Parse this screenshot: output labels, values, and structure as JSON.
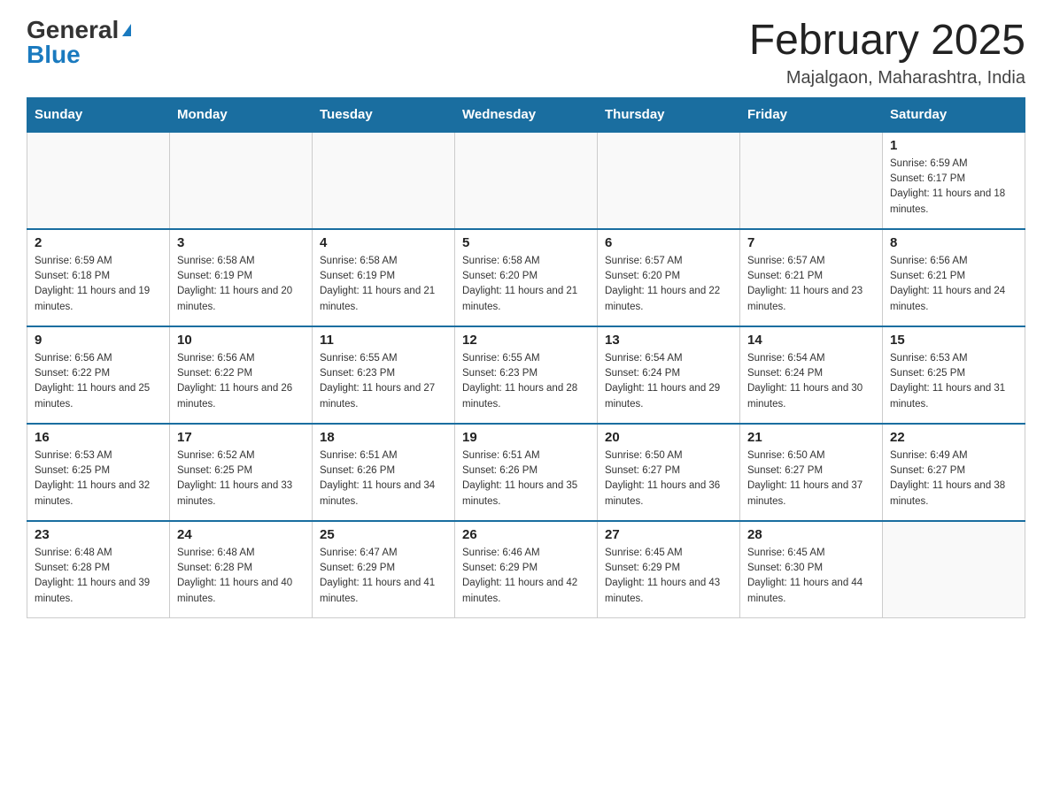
{
  "header": {
    "logo_general": "General",
    "logo_blue": "Blue",
    "month_title": "February 2025",
    "location": "Majalgaon, Maharashtra, India"
  },
  "days_of_week": [
    "Sunday",
    "Monday",
    "Tuesday",
    "Wednesday",
    "Thursday",
    "Friday",
    "Saturday"
  ],
  "weeks": [
    [
      {
        "day": "",
        "empty": true
      },
      {
        "day": "",
        "empty": true
      },
      {
        "day": "",
        "empty": true
      },
      {
        "day": "",
        "empty": true
      },
      {
        "day": "",
        "empty": true
      },
      {
        "day": "",
        "empty": true
      },
      {
        "day": "1",
        "sunrise": "Sunrise: 6:59 AM",
        "sunset": "Sunset: 6:17 PM",
        "daylight": "Daylight: 11 hours and 18 minutes."
      }
    ],
    [
      {
        "day": "2",
        "sunrise": "Sunrise: 6:59 AM",
        "sunset": "Sunset: 6:18 PM",
        "daylight": "Daylight: 11 hours and 19 minutes."
      },
      {
        "day": "3",
        "sunrise": "Sunrise: 6:58 AM",
        "sunset": "Sunset: 6:19 PM",
        "daylight": "Daylight: 11 hours and 20 minutes."
      },
      {
        "day": "4",
        "sunrise": "Sunrise: 6:58 AM",
        "sunset": "Sunset: 6:19 PM",
        "daylight": "Daylight: 11 hours and 21 minutes."
      },
      {
        "day": "5",
        "sunrise": "Sunrise: 6:58 AM",
        "sunset": "Sunset: 6:20 PM",
        "daylight": "Daylight: 11 hours and 21 minutes."
      },
      {
        "day": "6",
        "sunrise": "Sunrise: 6:57 AM",
        "sunset": "Sunset: 6:20 PM",
        "daylight": "Daylight: 11 hours and 22 minutes."
      },
      {
        "day": "7",
        "sunrise": "Sunrise: 6:57 AM",
        "sunset": "Sunset: 6:21 PM",
        "daylight": "Daylight: 11 hours and 23 minutes."
      },
      {
        "day": "8",
        "sunrise": "Sunrise: 6:56 AM",
        "sunset": "Sunset: 6:21 PM",
        "daylight": "Daylight: 11 hours and 24 minutes."
      }
    ],
    [
      {
        "day": "9",
        "sunrise": "Sunrise: 6:56 AM",
        "sunset": "Sunset: 6:22 PM",
        "daylight": "Daylight: 11 hours and 25 minutes."
      },
      {
        "day": "10",
        "sunrise": "Sunrise: 6:56 AM",
        "sunset": "Sunset: 6:22 PM",
        "daylight": "Daylight: 11 hours and 26 minutes."
      },
      {
        "day": "11",
        "sunrise": "Sunrise: 6:55 AM",
        "sunset": "Sunset: 6:23 PM",
        "daylight": "Daylight: 11 hours and 27 minutes."
      },
      {
        "day": "12",
        "sunrise": "Sunrise: 6:55 AM",
        "sunset": "Sunset: 6:23 PM",
        "daylight": "Daylight: 11 hours and 28 minutes."
      },
      {
        "day": "13",
        "sunrise": "Sunrise: 6:54 AM",
        "sunset": "Sunset: 6:24 PM",
        "daylight": "Daylight: 11 hours and 29 minutes."
      },
      {
        "day": "14",
        "sunrise": "Sunrise: 6:54 AM",
        "sunset": "Sunset: 6:24 PM",
        "daylight": "Daylight: 11 hours and 30 minutes."
      },
      {
        "day": "15",
        "sunrise": "Sunrise: 6:53 AM",
        "sunset": "Sunset: 6:25 PM",
        "daylight": "Daylight: 11 hours and 31 minutes."
      }
    ],
    [
      {
        "day": "16",
        "sunrise": "Sunrise: 6:53 AM",
        "sunset": "Sunset: 6:25 PM",
        "daylight": "Daylight: 11 hours and 32 minutes."
      },
      {
        "day": "17",
        "sunrise": "Sunrise: 6:52 AM",
        "sunset": "Sunset: 6:25 PM",
        "daylight": "Daylight: 11 hours and 33 minutes."
      },
      {
        "day": "18",
        "sunrise": "Sunrise: 6:51 AM",
        "sunset": "Sunset: 6:26 PM",
        "daylight": "Daylight: 11 hours and 34 minutes."
      },
      {
        "day": "19",
        "sunrise": "Sunrise: 6:51 AM",
        "sunset": "Sunset: 6:26 PM",
        "daylight": "Daylight: 11 hours and 35 minutes."
      },
      {
        "day": "20",
        "sunrise": "Sunrise: 6:50 AM",
        "sunset": "Sunset: 6:27 PM",
        "daylight": "Daylight: 11 hours and 36 minutes."
      },
      {
        "day": "21",
        "sunrise": "Sunrise: 6:50 AM",
        "sunset": "Sunset: 6:27 PM",
        "daylight": "Daylight: 11 hours and 37 minutes."
      },
      {
        "day": "22",
        "sunrise": "Sunrise: 6:49 AM",
        "sunset": "Sunset: 6:27 PM",
        "daylight": "Daylight: 11 hours and 38 minutes."
      }
    ],
    [
      {
        "day": "23",
        "sunrise": "Sunrise: 6:48 AM",
        "sunset": "Sunset: 6:28 PM",
        "daylight": "Daylight: 11 hours and 39 minutes."
      },
      {
        "day": "24",
        "sunrise": "Sunrise: 6:48 AM",
        "sunset": "Sunset: 6:28 PM",
        "daylight": "Daylight: 11 hours and 40 minutes."
      },
      {
        "day": "25",
        "sunrise": "Sunrise: 6:47 AM",
        "sunset": "Sunset: 6:29 PM",
        "daylight": "Daylight: 11 hours and 41 minutes."
      },
      {
        "day": "26",
        "sunrise": "Sunrise: 6:46 AM",
        "sunset": "Sunset: 6:29 PM",
        "daylight": "Daylight: 11 hours and 42 minutes."
      },
      {
        "day": "27",
        "sunrise": "Sunrise: 6:45 AM",
        "sunset": "Sunset: 6:29 PM",
        "daylight": "Daylight: 11 hours and 43 minutes."
      },
      {
        "day": "28",
        "sunrise": "Sunrise: 6:45 AM",
        "sunset": "Sunset: 6:30 PM",
        "daylight": "Daylight: 11 hours and 44 minutes."
      },
      {
        "day": "",
        "empty": true
      }
    ]
  ]
}
